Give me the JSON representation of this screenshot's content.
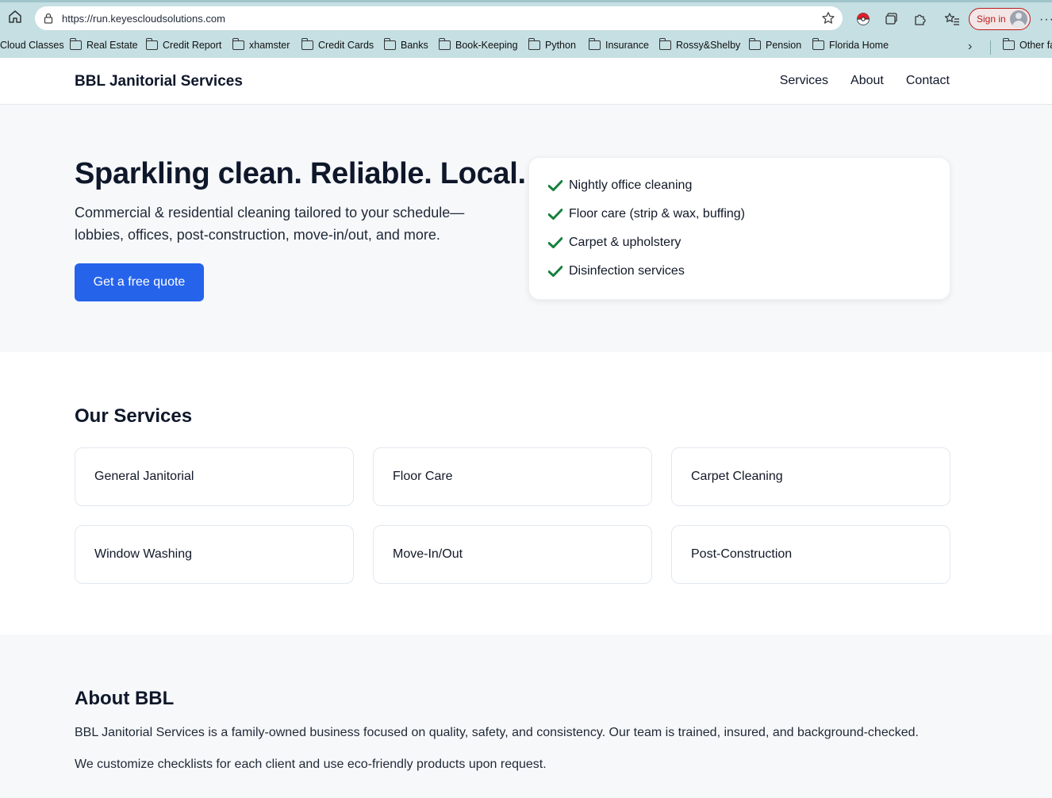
{
  "browser": {
    "url": "https://run.keyescloudsolutions.com",
    "signin_label": "Sign in",
    "more_label": "···",
    "bookmarks": [
      "Cloud Classes",
      "Real Estate",
      "Credit Report",
      "xhamster",
      "Credit Cards",
      "Banks",
      "Book-Keeping",
      "Python",
      "Insurance",
      "Rossy&Shelby",
      "Pension",
      "Florida Home"
    ],
    "other_bookmarks": "Other fa",
    "bookmarks_chevron": "›"
  },
  "site": {
    "brand": "BBL Janitorial Services",
    "nav": [
      "Services",
      "About",
      "Contact"
    ]
  },
  "hero": {
    "title": "Sparkling clean. Reliable. Local.",
    "subtitle": "Commercial & residential cleaning tailored to your schedule—lobbies, offices, post-construction, move-in/out, and more.",
    "cta": "Get a free quote",
    "checklist": [
      "Nightly office cleaning",
      "Floor care (strip & wax, buffing)",
      "Carpet & upholstery",
      "Disinfection services"
    ]
  },
  "services": {
    "title": "Our Services",
    "items": [
      "General Janitorial",
      "Floor Care",
      "Carpet Cleaning",
      "Window Washing",
      "Move-In/Out",
      "Post-Construction"
    ]
  },
  "about": {
    "title": "About BBL",
    "p1": "BBL Janitorial Services is a family-owned business focused on quality, safety, and consistency. Our team is trained, insured, and background-checked.",
    "p2": "We customize checklists for each client and use eco-friendly products upon request."
  },
  "colors": {
    "accent": "#2563eb",
    "check": "#15803d",
    "chrome": "#c5dfe3"
  }
}
